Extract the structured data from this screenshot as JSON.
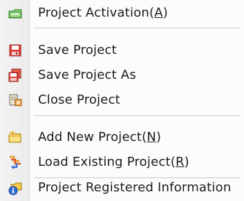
{
  "menu": {
    "items": [
      {
        "label": "Project Activation(",
        "hotkey": "A",
        "suffix": ")",
        "icon": "folder-activate-icon"
      },
      {
        "label": "Save Project",
        "icon": "save-disk-icon"
      },
      {
        "label": "Save Project As",
        "icon": "save-as-disk-icon"
      },
      {
        "label": "Close Project",
        "icon": "close-project-icon"
      },
      {
        "label": "Add New Project(",
        "hotkey": "N",
        "suffix": ")",
        "icon": "add-project-icon"
      },
      {
        "label": "Load Existing Project(",
        "hotkey": "R",
        "suffix": ")",
        "icon": "load-project-icon"
      },
      {
        "label": "Project Registered Information",
        "icon": "project-info-icon"
      }
    ]
  },
  "colors": {
    "menu_background": "#fcfcfc",
    "separator": "#c8c8c8",
    "text": "#1a1a1a"
  }
}
